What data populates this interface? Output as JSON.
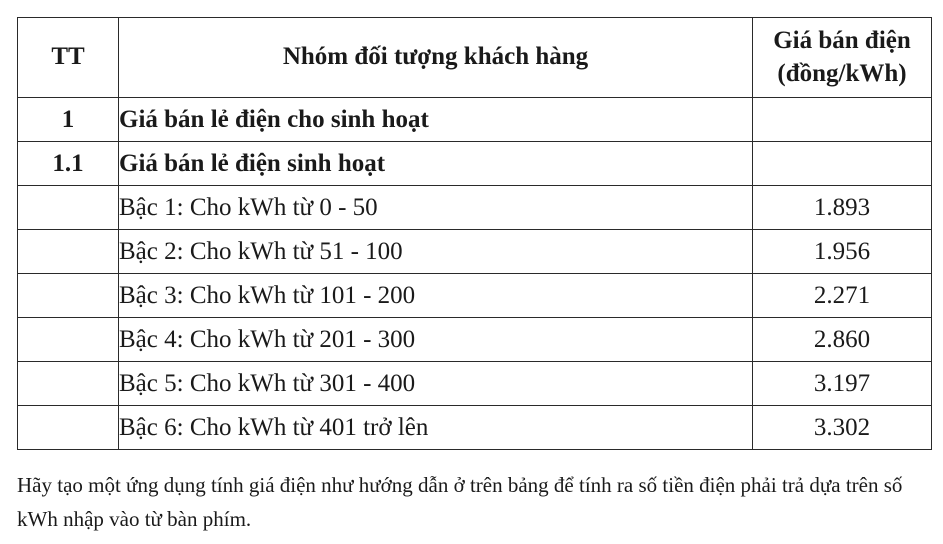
{
  "table": {
    "headers": {
      "tt": "TT",
      "group": "Nhóm đối tượng khách hàng",
      "price": "Giá bán điện\n(đồng/kWh)"
    },
    "rows": [
      {
        "tt": "1",
        "group": "Giá bán lẻ điện cho sinh hoạt",
        "price": "",
        "bold": true
      },
      {
        "tt": "1.1",
        "group": "Giá bán lẻ điện sinh hoạt",
        "price": "",
        "bold": true
      },
      {
        "tt": "",
        "group": "Bậc 1: Cho kWh từ 0 - 50",
        "price": "1.893",
        "bold": false
      },
      {
        "tt": "",
        "group": "Bậc 2: Cho kWh từ 51 - 100",
        "price": "1.956",
        "bold": false
      },
      {
        "tt": "",
        "group": "Bậc 3: Cho kWh từ 101 - 200",
        "price": "2.271",
        "bold": false
      },
      {
        "tt": "",
        "group": "Bậc 4: Cho kWh từ 201 - 300",
        "price": "2.860",
        "bold": false
      },
      {
        "tt": "",
        "group": "Bậc 5: Cho kWh từ 301 - 400",
        "price": "3.197",
        "bold": false
      },
      {
        "tt": "",
        "group": "Bậc 6: Cho kWh từ 401 trở lên",
        "price": "3.302",
        "bold": false
      }
    ]
  },
  "task": {
    "text": "Hãy tạo một ứng dụng tính giá điện như hướng dẫn ở trên bảng để tính ra số tiền điện phải trả dựa trên số kWh nhập vào từ bàn phím."
  }
}
